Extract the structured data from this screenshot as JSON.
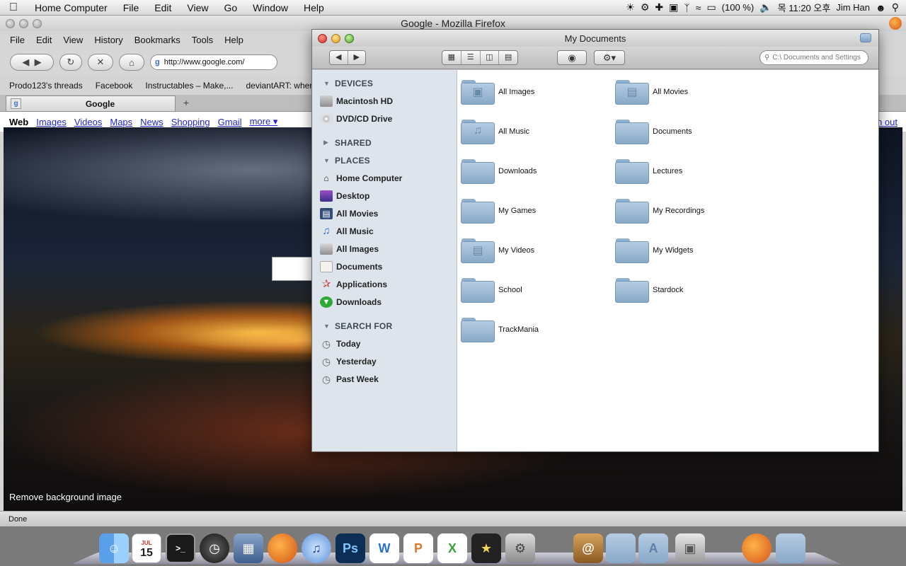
{
  "menubar": {
    "apple": "",
    "items": [
      "Home Computer",
      "File",
      "Edit",
      "View",
      "Go",
      "Window",
      "Help"
    ],
    "status": {
      "battery": "(100 %)",
      "clock": "목 11:20 오후",
      "user": "Jim Han"
    }
  },
  "firefox": {
    "title": "Google - Mozilla Firefox",
    "menu": [
      "File",
      "Edit",
      "View",
      "History",
      "Bookmarks",
      "Tools",
      "Help"
    ],
    "url": "http://www.google.com/",
    "bookmarks": [
      "Prodo123's threads",
      "Facebook",
      "Instructables – Make,...",
      "deviantART: where"
    ],
    "tab_title": "Google",
    "tab_new": "+",
    "google_links": [
      "Web",
      "Images",
      "Videos",
      "Maps",
      "News",
      "Shopping",
      "Gmail",
      "more ▾"
    ],
    "signout_tail": "n out",
    "remove_bg": "Remove background image",
    "status": "Done"
  },
  "finder": {
    "title": "My Documents",
    "search_placeholder": "C:\\  Documents and Settings",
    "sidebar": {
      "devices_head": "DEVICES",
      "devices": [
        "Macintosh HD",
        "DVD/CD Drive"
      ],
      "shared_head": "SHARED",
      "places_head": "PLACES",
      "places": [
        "Home Computer",
        "Desktop",
        "All Movies",
        "All Music",
        "All Images",
        "Documents",
        "Applications",
        "Downloads"
      ],
      "search_head": "SEARCH FOR",
      "search": [
        "Today",
        "Yesterday",
        "Past Week"
      ]
    },
    "items": [
      "All Images",
      "All Movies",
      "All Music",
      "Documents",
      "Downloads",
      "Lectures",
      "My Games",
      "My Recordings",
      "My Videos",
      "My Widgets",
      "School",
      "Stardock",
      "TrackMania"
    ]
  },
  "dock": {
    "calendar_month": "JUL",
    "calendar_day": "15"
  },
  "colors": {
    "finder_sidebar": "#dde4ec",
    "folder_blue": "#9fbad6",
    "link_blue": "#2026c9"
  }
}
